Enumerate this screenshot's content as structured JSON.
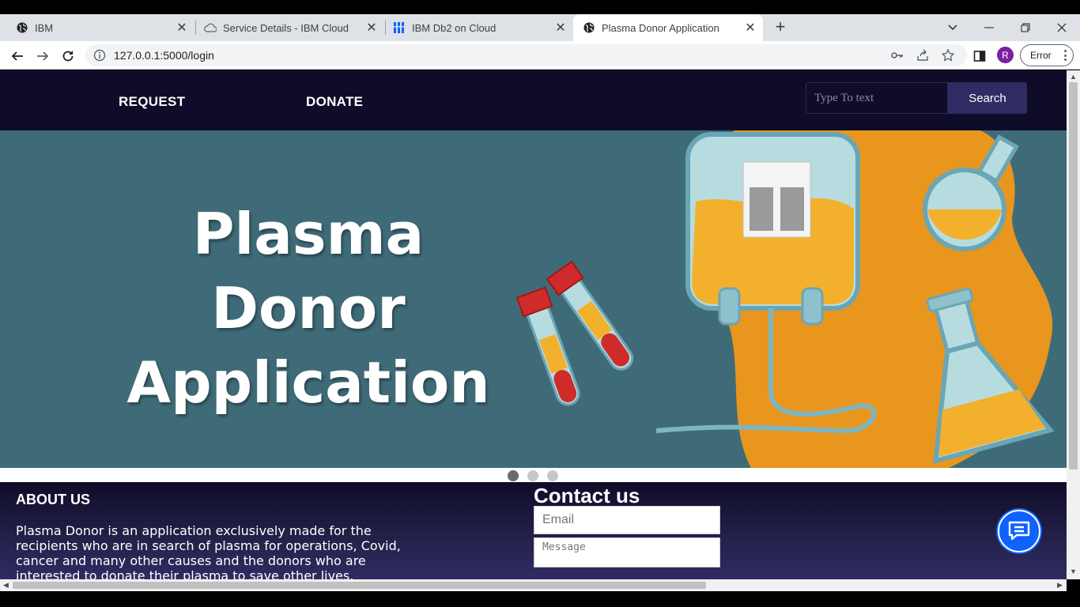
{
  "browser": {
    "tabs": [
      {
        "title": "IBM",
        "icon": "globe-icon",
        "active": false
      },
      {
        "title": "Service Details - IBM Cloud",
        "icon": "cloud-icon",
        "active": false
      },
      {
        "title": "IBM Db2 on Cloud",
        "icon": "db2-icon",
        "active": false
      },
      {
        "title": "Plasma Donor Application",
        "icon": "globe-icon",
        "active": true
      }
    ],
    "url": "127.0.0.1:5000/login",
    "avatar_initial": "R",
    "error_label": "Error"
  },
  "nav": {
    "request_label": "REQUEST",
    "donate_label": "DONATE",
    "search_placeholder": "Type To text",
    "search_button": "Search"
  },
  "hero": {
    "title_line1": "Plasma Donor",
    "title_line2": "Application",
    "slides": 3,
    "active_slide": 1
  },
  "footer": {
    "about_heading": "ABOUT US",
    "about_text": "Plasma Donor is an application exclusively made for the recipients who are in search of plasma for operations, Covid, cancer and many other causes and the donors who are interested to donate their plasma to save other lives.",
    "contact_heading": "Contact us",
    "email_placeholder": "Email",
    "message_placeholder": "Message"
  },
  "colors": {
    "nav_bg": "#0f0c29",
    "search_button_bg": "#302b63",
    "hero_bg": "#3f6b78",
    "chat_button": "#0f62fe"
  }
}
